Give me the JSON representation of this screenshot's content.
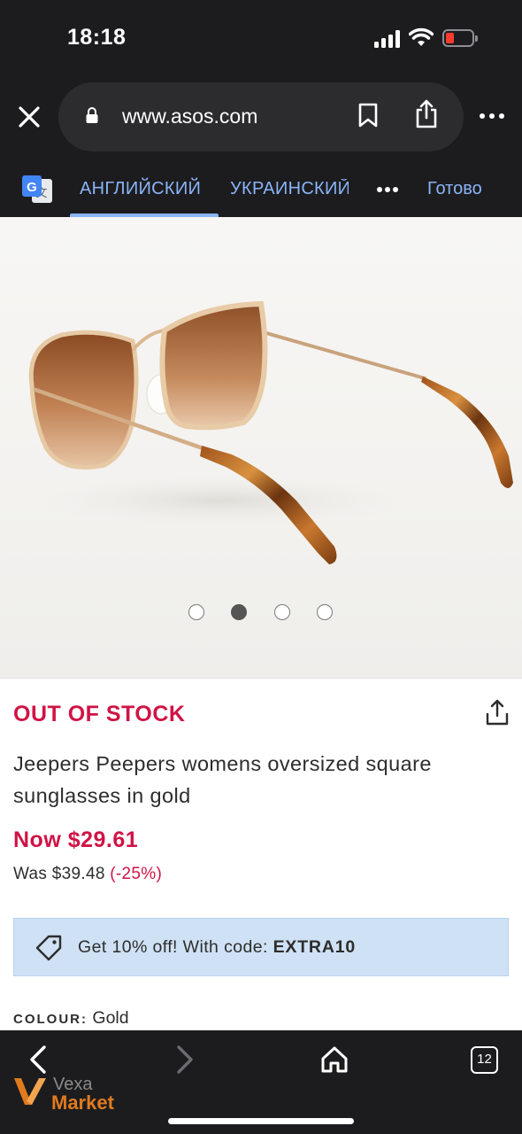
{
  "status_bar": {
    "time": "18:18",
    "battery_level": 0.15,
    "battery_color": "#ff3b30"
  },
  "browser": {
    "url": "www.asos.com"
  },
  "translate_bar": {
    "source_language": "АНГЛИЙСКИЙ",
    "target_language": "УКРАИНСКИЙ",
    "done_label": "Готово",
    "accent_color": "#8ab4f8"
  },
  "product": {
    "stock_status": "OUT OF STOCK",
    "title": "Jeepers Peepers womens oversized square sunglasses in gold",
    "price_now": "Now $29.61",
    "price_was": "Was $39.48",
    "discount": "(-25%)",
    "promo_text": "Get 10% off! With code:",
    "promo_code": "EXTRA10",
    "colour_label": "COLOUR:",
    "colour_value": "Gold",
    "accent_color": "#d01345",
    "image_count": 4,
    "active_image_index": 1
  },
  "toolbar": {
    "tab_count": "12"
  },
  "watermark": {
    "line1": "Vexa",
    "line2": "Market"
  }
}
